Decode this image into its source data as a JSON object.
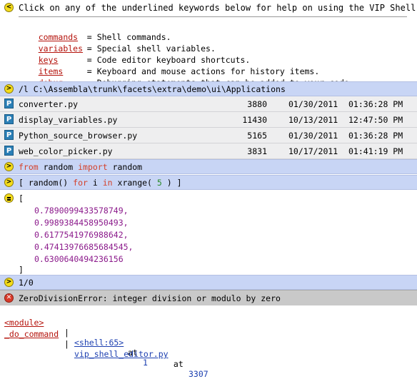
{
  "help": {
    "header": "Click on any of the underlined keywords below for help on using the VIP Shell:",
    "items": [
      {
        "keyword": "commands",
        "desc": "Shell commands."
      },
      {
        "keyword": "variables",
        "desc": "Special shell variables."
      },
      {
        "keyword": "keys",
        "desc": "Code editor keyboard shortcuts."
      },
      {
        "keyword": "items",
        "desc": "Keyboard and mouse actions for history items."
      },
      {
        "keyword": "debug",
        "desc": "Debugging statements that can be added to your code."
      }
    ]
  },
  "listing_cmd": "/l C:\\Assembla\\trunk\\facets\\extra\\demo\\ui\\Applications",
  "files": [
    {
      "name": "converter.py",
      "size": "3880",
      "date": "01/30/2011",
      "time": "01:36:28 PM"
    },
    {
      "name": "display_variables.py",
      "size": "11430",
      "date": "10/13/2011",
      "time": "12:47:50 PM"
    },
    {
      "name": "Python_source_browser.py",
      "size": "5165",
      "date": "01/30/2011",
      "time": "01:36:28 PM"
    },
    {
      "name": "web_color_picker.py",
      "size": "3831",
      "date": "10/17/2011",
      "time": "01:41:19 PM"
    }
  ],
  "file_icon_letter": "P",
  "import_cmd": {
    "kw1": "from",
    "mod": " random ",
    "kw2": "import",
    "name": " random"
  },
  "comp_cmd": {
    "p1": "[ random() ",
    "kw1": "for",
    "p2": " i ",
    "kw2": "in",
    "p3": " xrange( ",
    "n": "5",
    "p4": " ) ]"
  },
  "result": {
    "open": "[",
    "values": [
      "0.7890099433578749,",
      "0.9989384458950493,",
      "0.6177541976988642,",
      "0.47413976685684545,",
      "0.6300640494236156"
    ],
    "close": "]"
  },
  "div_cmd": "1/0",
  "error": "ZeroDivisionError: integer division or modulo by zero",
  "traceback": [
    {
      "func": "<module>",
      "file": "<shell:65>",
      "at": " at ",
      "line": "1"
    },
    {
      "func": "_do_command",
      "file": "vip_shell_editor.py",
      "at": " at ",
      "line": "3307"
    }
  ],
  "icons": {
    "prompt": "prompt-chevron-icon",
    "result": "result-equals-icon",
    "error": "error-x-icon",
    "python_file": "python-file-icon"
  },
  "colors": {
    "keyword_link": "#b4120b",
    "bar_blue": "#c8d5f5",
    "number": "#8b1a8b",
    "file_link": "#1c3fb0"
  }
}
